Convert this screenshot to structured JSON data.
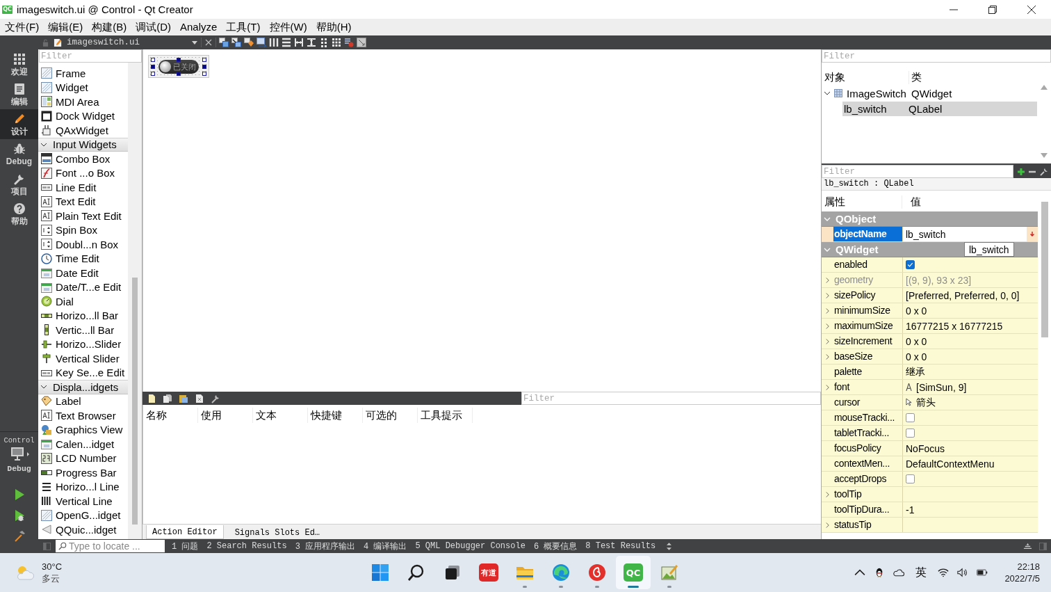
{
  "window": {
    "logo": "QC",
    "title": "imageswitch.ui @ Control - Qt Creator"
  },
  "menu_bar": [
    "文件(F)",
    "编辑(E)",
    "构建(B)",
    "调试(D)",
    "Analyze",
    "工具(T)",
    "控件(W)",
    "帮助(H)"
  ],
  "mode_bar": {
    "modes": [
      {
        "label": "欢迎",
        "selected": false
      },
      {
        "label": "编辑",
        "selected": false
      },
      {
        "label": "设计",
        "selected": true
      },
      {
        "label": "Debug",
        "selected": false
      },
      {
        "label": "项目",
        "selected": false
      },
      {
        "label": "帮助",
        "selected": false
      }
    ],
    "kit": {
      "project": "Control",
      "build": "Debug"
    }
  },
  "document_bar": {
    "file": "imageswitch.ui"
  },
  "widget_box": {
    "filter": {
      "placeholder": "Filter"
    },
    "items": [
      {
        "kind": "widget",
        "label": "Frame"
      },
      {
        "kind": "widget",
        "label": "Widget"
      },
      {
        "kind": "widget",
        "label": "MDI Area"
      },
      {
        "kind": "widget",
        "label": "Dock Widget"
      },
      {
        "kind": "widget",
        "label": "QAxWidget"
      },
      {
        "kind": "category",
        "label": "Input Widgets",
        "expanded": true
      },
      {
        "kind": "widget",
        "label": "Combo Box"
      },
      {
        "kind": "widget",
        "label": "Font ...o Box"
      },
      {
        "kind": "widget",
        "label": "Line Edit"
      },
      {
        "kind": "widget",
        "label": "Text Edit"
      },
      {
        "kind": "widget",
        "label": "Plain Text Edit"
      },
      {
        "kind": "widget",
        "label": "Spin Box"
      },
      {
        "kind": "widget",
        "label": "Doubl...n Box"
      },
      {
        "kind": "widget",
        "label": "Time Edit"
      },
      {
        "kind": "widget",
        "label": "Date Edit"
      },
      {
        "kind": "widget",
        "label": "Date/T...e Edit"
      },
      {
        "kind": "widget",
        "label": "Dial"
      },
      {
        "kind": "widget",
        "label": "Horizo...ll Bar"
      },
      {
        "kind": "widget",
        "label": "Vertic...ll Bar"
      },
      {
        "kind": "widget",
        "label": "Horizo...Slider"
      },
      {
        "kind": "widget",
        "label": "Vertical Slider"
      },
      {
        "kind": "widget",
        "label": "Key Se...e Edit"
      },
      {
        "kind": "category",
        "label": "Displa...idgets",
        "expanded": true
      },
      {
        "kind": "widget",
        "label": "Label"
      },
      {
        "kind": "widget",
        "label": "Text Browser"
      },
      {
        "kind": "widget",
        "label": "Graphics View"
      },
      {
        "kind": "widget",
        "label": "Calen...idget"
      },
      {
        "kind": "widget",
        "label": "LCD Number"
      },
      {
        "kind": "widget",
        "label": "Progress Bar"
      },
      {
        "kind": "widget",
        "label": "Horizo...l Line"
      },
      {
        "kind": "widget",
        "label": "Vertical Line"
      },
      {
        "kind": "widget",
        "label": "OpenG...idget"
      },
      {
        "kind": "widget",
        "label": "QQuic...idget"
      }
    ]
  },
  "form": {
    "switch_label": "已关闭",
    "selected": true
  },
  "action_editor": {
    "filter": {
      "placeholder": "Filter"
    },
    "columns": [
      "名称",
      "使用",
      "文本",
      "快捷键",
      "可选的",
      "工具提示"
    ],
    "tabs": [
      {
        "label": "Action Editor",
        "selected": true
      },
      {
        "label": "Signals Slots Ed…",
        "selected": false
      }
    ]
  },
  "object_inspector": {
    "filter": {
      "placeholder": "Filter"
    },
    "columns": [
      "对象",
      "类"
    ],
    "tree": [
      {
        "object": "ImageSwitch",
        "class": "QWidget",
        "expanded": true,
        "selected": false,
        "children": [
          {
            "object": "lb_switch",
            "class": "QLabel",
            "selected": true
          }
        ]
      }
    ]
  },
  "property_editor": {
    "filter": {
      "placeholder": "Filter"
    },
    "context": "lb_switch : QLabel",
    "columns": [
      "属性",
      "值"
    ],
    "groups": [
      {
        "name": "QObject",
        "expanded": true,
        "selected": false,
        "color": "#fbe3c6",
        "properties": [
          {
            "name": "objectName",
            "kind": "text",
            "value": "lb_switch",
            "expandable": false,
            "disabled": false,
            "selected": true
          }
        ]
      },
      {
        "name": "QWidget",
        "expanded": true,
        "selected": false,
        "color": "#fcfad2",
        "properties": [
          {
            "name": "enabled",
            "kind": "checkbox",
            "checked": true,
            "expandable": false,
            "disabled": false,
            "selected": false
          },
          {
            "name": "geometry",
            "kind": "text",
            "value": "[(9, 9), 93 x 23]",
            "expandable": true,
            "disabled": true,
            "selected": false
          },
          {
            "name": "sizePolicy",
            "kind": "text",
            "value": "[Preferred, Preferred, 0, 0]",
            "expandable": true,
            "disabled": false,
            "selected": false
          },
          {
            "name": "minimumSize",
            "kind": "text",
            "value": "0 x 0",
            "expandable": true,
            "disabled": false,
            "selected": false
          },
          {
            "name": "maximumSize",
            "kind": "text",
            "value": "16777215 x 16777215",
            "expandable": true,
            "disabled": false,
            "selected": false
          },
          {
            "name": "sizeIncrement",
            "kind": "text",
            "value": "0 x 0",
            "expandable": true,
            "disabled": false,
            "selected": false
          },
          {
            "name": "baseSize",
            "kind": "text",
            "value": "0 x 0",
            "expandable": true,
            "disabled": false,
            "selected": false
          },
          {
            "name": "palette",
            "kind": "text",
            "value": "继承",
            "expandable": false,
            "disabled": false,
            "selected": false
          },
          {
            "name": "font",
            "kind": "font",
            "value": "[SimSun, 9]",
            "expandable": true,
            "disabled": false,
            "selected": false
          },
          {
            "name": "cursor",
            "kind": "cursor",
            "value": "箭头",
            "expandable": false,
            "disabled": false,
            "selected": false
          },
          {
            "name": "mouseTracki...",
            "kind": "checkbox",
            "checked": false,
            "expandable": false,
            "disabled": false,
            "selected": false
          },
          {
            "name": "tabletTracki...",
            "kind": "checkbox",
            "checked": false,
            "expandable": false,
            "disabled": false,
            "selected": false
          },
          {
            "name": "focusPolicy",
            "kind": "text",
            "value": "NoFocus",
            "expandable": false,
            "disabled": false,
            "selected": false
          },
          {
            "name": "contextMen...",
            "kind": "text",
            "value": "DefaultContextMenu",
            "expandable": false,
            "disabled": false,
            "selected": false
          },
          {
            "name": "acceptDrops",
            "kind": "checkbox",
            "checked": false,
            "expandable": false,
            "disabled": false,
            "selected": false
          },
          {
            "name": "toolTip",
            "kind": "text",
            "expandable": true,
            "disabled": false,
            "selected": false
          },
          {
            "name": "toolTipDura...",
            "kind": "text",
            "value": "-1",
            "expandable": false,
            "disabled": false,
            "selected": false
          },
          {
            "name": "statusTip",
            "kind": "text",
            "expandable": true,
            "disabled": false,
            "selected": false
          }
        ]
      }
    ],
    "tooltip": "lb_switch"
  },
  "status_bar": {
    "locator": {
      "placeholder": "Type to locate ..."
    },
    "panes": [
      "1 问题",
      "2 Search Results",
      "3 应用程序输出",
      "4 编译输出",
      "5 QML Debugger Console",
      "6 概要信息",
      "8 Test Results"
    ]
  },
  "taskbar": {
    "weather": {
      "temperature": "30°C",
      "condition": "多云"
    },
    "apps": [
      {
        "running": false,
        "selected": false
      },
      {
        "running": false,
        "selected": false
      },
      {
        "running": false,
        "selected": false
      },
      {
        "label": "有道",
        "running": false,
        "selected": false
      },
      {
        "running": true,
        "selected": false
      },
      {
        "running": true,
        "selected": false
      },
      {
        "running": true,
        "selected": false
      },
      {
        "label": "QC",
        "running": true,
        "selected": true
      },
      {
        "running": true,
        "selected": false
      }
    ],
    "tray": {
      "input_method": "英",
      "time": "22:18",
      "date": "2022/7/5"
    }
  }
}
